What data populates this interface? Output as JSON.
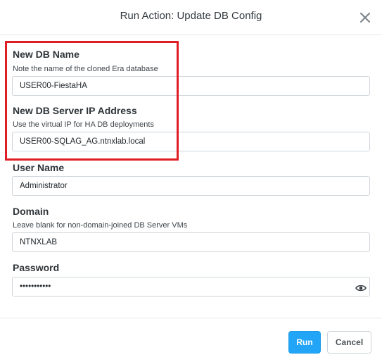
{
  "dialog": {
    "title": "Run Action: Update DB Config"
  },
  "fields": {
    "db_name": {
      "label": "New DB Name",
      "help": "Note the name of the cloned Era database",
      "value": "USER00-FiestaHA"
    },
    "db_server_ip": {
      "label": "New DB Server IP Address",
      "help": "Use the virtual IP for HA DB deployments",
      "value": "USER00-SQLAG_AG.ntnxlab.local"
    },
    "user_name": {
      "label": "User Name",
      "value": "Administrator"
    },
    "domain": {
      "label": "Domain",
      "help": "Leave blank for non-domain-joined DB Server VMs",
      "value": "NTNXLAB"
    },
    "password": {
      "label": "Password",
      "value": "•••••••••••"
    }
  },
  "footer": {
    "run_label": "Run",
    "cancel_label": "Cancel"
  },
  "icons": {
    "close": "close-icon",
    "eye": "eye-icon"
  },
  "colors": {
    "primary": "#22a5f7",
    "highlight": "#e01c24"
  }
}
